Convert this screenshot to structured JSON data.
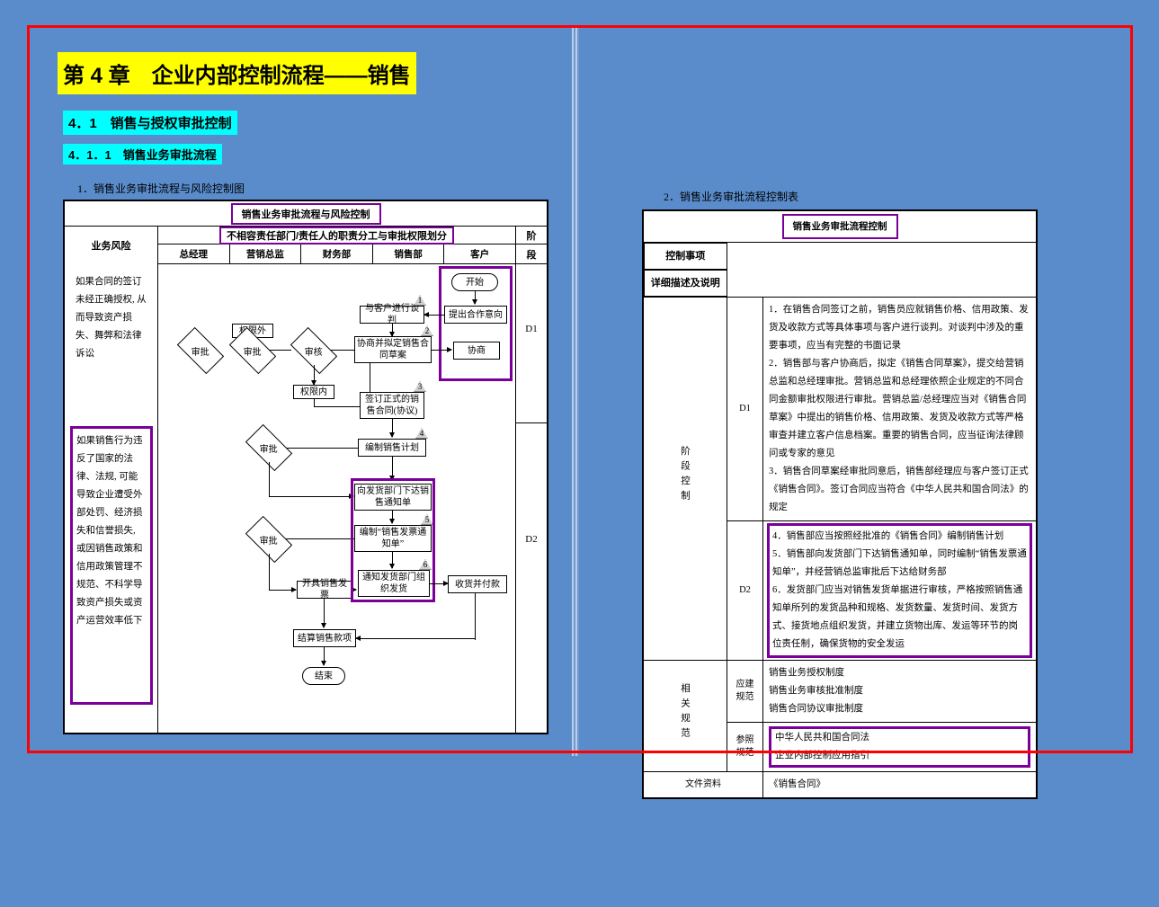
{
  "chapter_title": "第 4 章　企业内部控制流程——销售",
  "section_4_1": "4．1　销售与授权审批控制",
  "section_4_1_1": "4．1．1　销售业务审批流程",
  "left_caption": "1．销售业务审批流程与风险控制图",
  "right_caption": "2．销售业务审批流程控制表",
  "diagram": {
    "title": "销售业务审批流程与风险控制",
    "risk_header": "业务风险",
    "dept_header": "不相容责任部门/责任人的职责分工与审批权限划分",
    "phase_header": "阶段",
    "columns": [
      "总经理",
      "营销总监",
      "财务部",
      "销售部",
      "客户"
    ],
    "phase_labels": [
      "D1",
      "D2"
    ],
    "risk_1": "如果合同的签订未经正确授权, 从而导致资产损失、舞弊和法律诉讼",
    "risk_2": "如果销售行为违反了国家的法律、法规, 可能导致企业遭受外部处罚、经济损失和信誉损失, 或因销售政策和信用政策管理不规范、不科学导致资产损失或资产运营效率低下",
    "nodes": {
      "start": "开始",
      "intent": "提出合作意向",
      "negotiate": "与客户进行谈判",
      "draft": "协商并拟定销售合同草案",
      "contract_doc": "协商",
      "approve1": "审批",
      "review": "审核",
      "over_limit": "权限外",
      "in_limit": "权限内",
      "sign": "签订正式的销售合同(协议)",
      "plan": "编制销售计划",
      "approve2": "审批",
      "notify_ship": "向发货部门下达销售通知单",
      "settle_bill": "编制“销售发票通知单”",
      "approve3": "审批",
      "issue_invoice": "开具销售发票",
      "org_ship": "通知发货部门组织发货",
      "receive_pay": "收货并付款",
      "settle": "结算销售款项",
      "end": "结束"
    },
    "badges": [
      "1",
      "2",
      "3",
      "4",
      "5",
      "6"
    ]
  },
  "ctrl_table": {
    "title": "销售业务审批流程控制",
    "control_item_header": "控制事项",
    "desc_header": "详细描述及说明",
    "phase_ctrl_label": "阶段控制",
    "d1_code": "D1",
    "d2_code": "D2",
    "d1_text": "1．在销售合同签订之前，销售员应就销售价格、信用政策、发货及收款方式等具体事项与客户进行谈判。对谈判中涉及的重要事项，应当有完整的书面记录\n2．销售部与客户协商后，拟定《销售合同草案》，提交给营销总监和总经理审批。营销总监和总经理依照企业规定的不同合同金额审批权限进行审批。营销总监/总经理应当对《销售合同草案》中提出的销售价格、信用政策、发货及收款方式等严格审查并建立客户信息档案。重要的销售合同，应当征询法律顾问或专家的意见\n3．销售合同草案经审批同意后，销售部经理应与客户签订正式《销售合同》。签订合同应当符合《中华人民共和国合同法》的规定",
    "d2_text": "4．销售部应当按照经批准的《销售合同》编制销售计划\n5．销售部向发货部门下达销售通知单，同时编制“销售发票通知单”，并经营销总监审批后下达给财务部\n6．发货部门应当对销售发货单据进行审核，严格按照销售通知单所列的发货品种和规格、发货数量、发货时间、发货方式、接货地点组织发货，并建立货物出库、发运等环节的岗位责任制，确保货物的安全发运",
    "related_label": "相关规范",
    "should_label": "应建规范",
    "should_items": [
      "销售业务授权制度",
      "销售业务审核批准制度",
      "销售合同协议审批制度"
    ],
    "ref_label": "参照规范",
    "ref_items": [
      "中华人民共和国合同法",
      "企业内部控制应用指引"
    ],
    "file_label": "文件资料",
    "file_items": "《销售合同》"
  }
}
